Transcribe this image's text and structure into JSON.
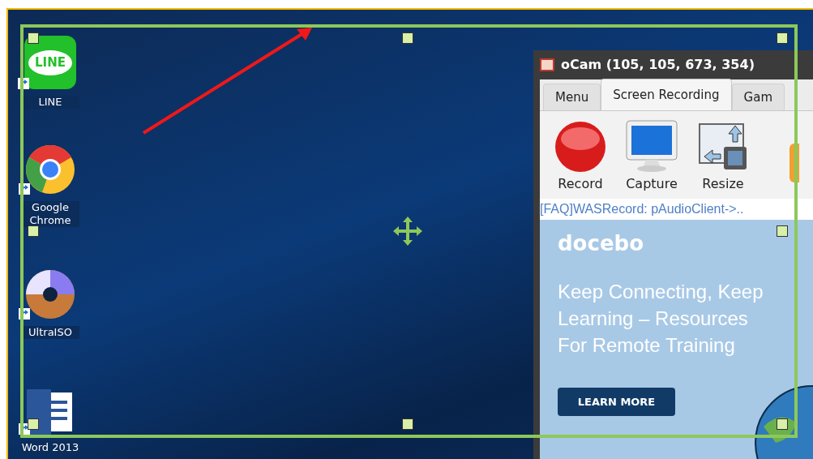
{
  "desktop_icons": [
    {
      "kind": "line",
      "label": "LINE",
      "logo_text": "LINE"
    },
    {
      "kind": "chrome",
      "label": "Google Chrome"
    },
    {
      "kind": "disc",
      "label": "UltraISO"
    },
    {
      "kind": "word",
      "label": "Word 2013"
    }
  ],
  "window": {
    "title": "oCam (105, 105, 673, 354)",
    "tabs": [
      {
        "label": "Menu",
        "selected": false
      },
      {
        "label": "Screen Recording",
        "selected": true
      },
      {
        "label": "Gam",
        "selected": false
      }
    ],
    "toolbar": [
      {
        "kind": "record",
        "label": "Record"
      },
      {
        "kind": "capture",
        "label": "Capture"
      },
      {
        "kind": "resize",
        "label": "Resize"
      },
      {
        "kind": "folder"
      }
    ],
    "status_link": "[FAQ]WASRecord: pAudioClient->..",
    "ad": {
      "brand": "docebo",
      "headline": [
        "Keep Connecting, Keep",
        "Learning – Resources",
        "For Remote Training"
      ],
      "button": "LEARN MORE"
    }
  }
}
